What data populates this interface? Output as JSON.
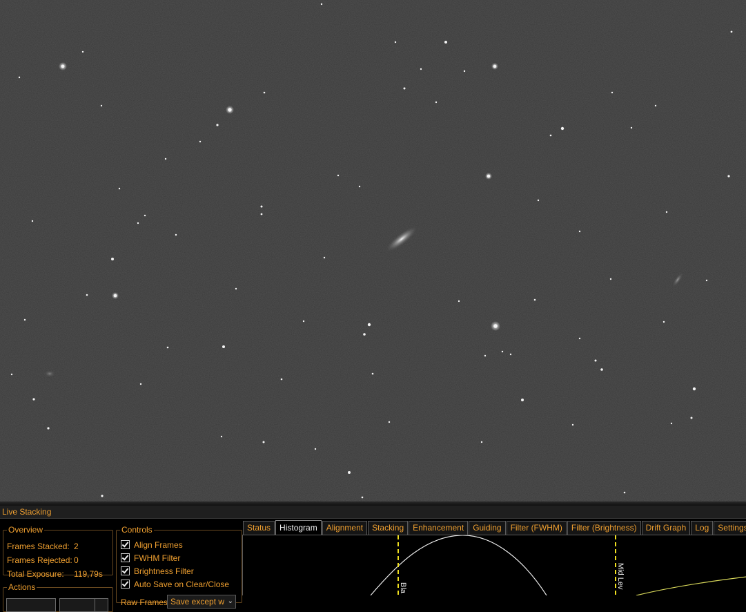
{
  "panel": {
    "title": "Live Stacking",
    "overview": {
      "legend": "Overview",
      "frames_stacked_label": "Frames Stacked:",
      "frames_stacked_value": "2",
      "frames_rejected_label": "Frames Rejected:",
      "frames_rejected_value": "0",
      "total_exposure_label": "Total Exposure:",
      "total_exposure_value": "119,79s"
    },
    "controls": {
      "legend": "Controls",
      "checkboxes": [
        {
          "label": "Align Frames",
          "checked": true
        },
        {
          "label": "FWHM Filter",
          "checked": true
        },
        {
          "label": "Brightness Filter",
          "checked": true
        },
        {
          "label": "Auto Save on Clear/Close",
          "checked": true
        }
      ],
      "raw_frames_label": "Raw Frames",
      "raw_frames_value": "Save except w"
    },
    "actions": {
      "legend": "Actions"
    },
    "tabs": [
      {
        "label": "Status",
        "active": false
      },
      {
        "label": "Histogram",
        "active": true
      },
      {
        "label": "Alignment",
        "active": false
      },
      {
        "label": "Stacking",
        "active": false
      },
      {
        "label": "Enhancement",
        "active": false
      },
      {
        "label": "Guiding",
        "active": false
      },
      {
        "label": "Filter (FWHM)",
        "active": false
      },
      {
        "label": "Filter (Brightness)",
        "active": false
      },
      {
        "label": "Drift Graph",
        "active": false
      },
      {
        "label": "Log",
        "active": false
      },
      {
        "label": "Settings",
        "active": false
      }
    ],
    "histogram": {
      "black_marker_label": "Bla",
      "mid_marker_label": "Mid Lev"
    }
  },
  "colors": {
    "accent": "#f0a030",
    "sky_background": "#3a3a3a",
    "marker": "#f0e020"
  }
}
